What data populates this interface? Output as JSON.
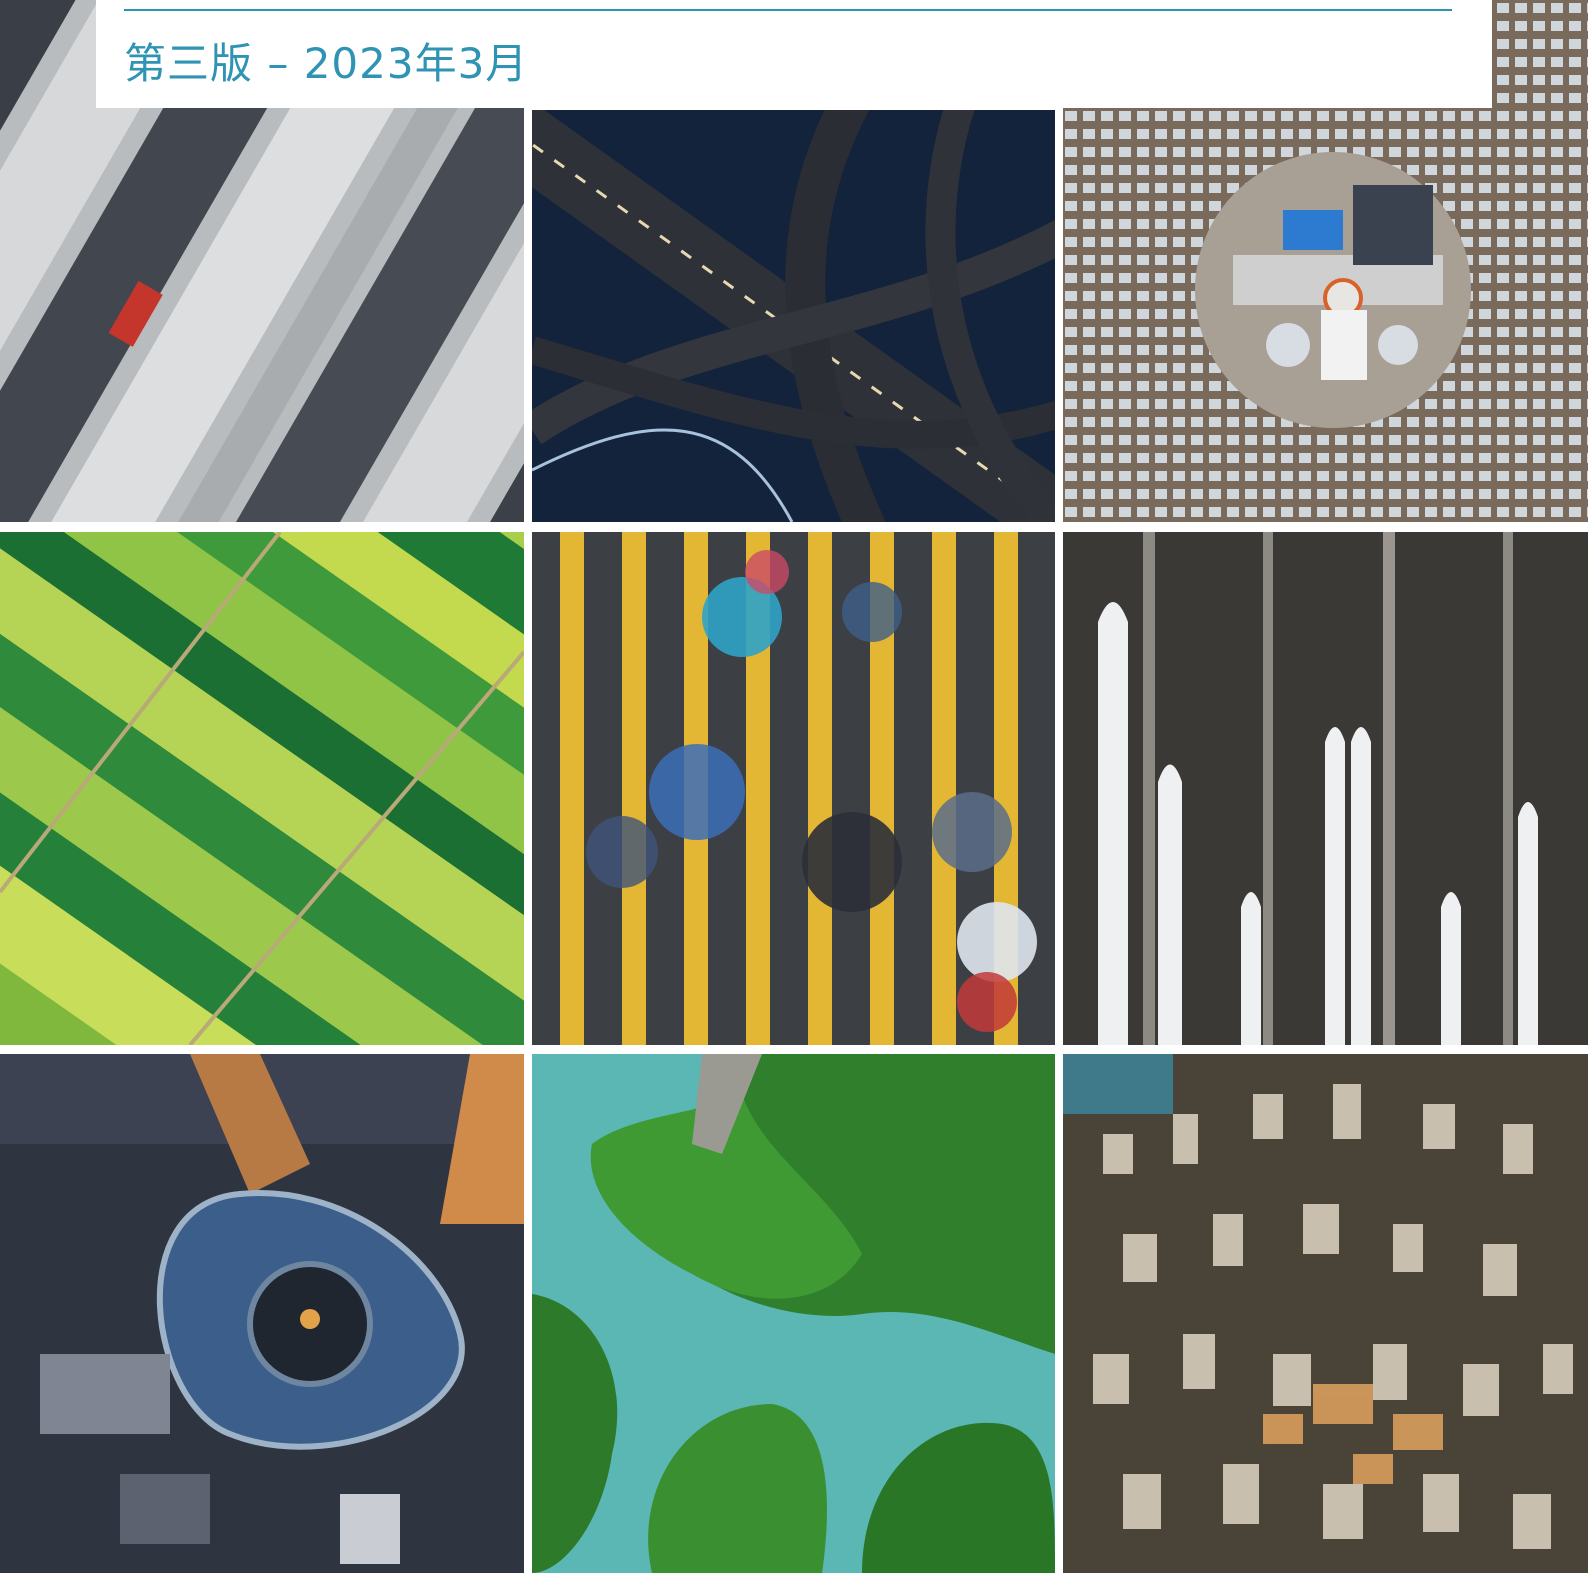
{
  "header": {
    "edition_text": "第三版 – 2023年3月",
    "accent_color": "#2f93b3"
  },
  "photos": [
    {
      "name": "parking-lot-aerial"
    },
    {
      "name": "highway-interchange-aerial"
    },
    {
      "name": "solar-power-plant-aerial"
    },
    {
      "name": "farmland-fields-aerial"
    },
    {
      "name": "pedestrian-crosswalk-umbrellas"
    },
    {
      "name": "high-speed-trains-aerial"
    },
    {
      "name": "skyscraper-rooftop-aerial"
    },
    {
      "name": "green-islands-lake-aerial"
    },
    {
      "name": "dense-city-towers-aerial"
    }
  ]
}
